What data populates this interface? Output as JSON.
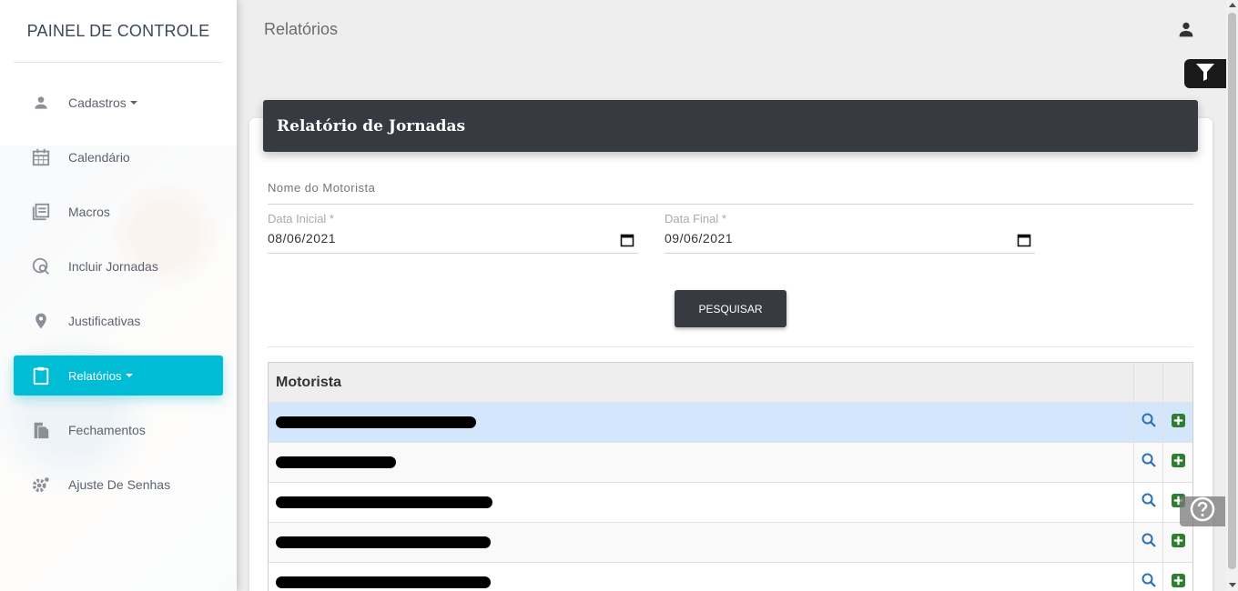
{
  "sidebar": {
    "brand": "PAINEL DE CONTROLE",
    "items": [
      {
        "label": "Cadastros",
        "icon": "person-icon",
        "caret": true
      },
      {
        "label": "Calendário",
        "icon": "calendar-icon"
      },
      {
        "label": "Macros",
        "icon": "library-books-icon"
      },
      {
        "label": "Incluir Jornadas",
        "icon": "search-document-icon"
      },
      {
        "label": "Justificativas",
        "icon": "location-pin-icon"
      },
      {
        "label": "Relatórios",
        "icon": "clipboard-icon",
        "caret": true,
        "active": true
      },
      {
        "label": "Fechamentos",
        "icon": "copy-document-icon"
      },
      {
        "label": "Ajuste De Senhas",
        "icon": "settings-cog-icon"
      }
    ]
  },
  "header": {
    "title": "Relatórios"
  },
  "card": {
    "title": "Relatório de Jornadas",
    "driver_name_placeholder": "Nome do Motorista",
    "start_date_label": "Data Inicial *",
    "start_date_value": "08/06/2021",
    "end_date_label": "Data Final *",
    "end_date_value": "09/06/2021",
    "search_button": "PESQUISAR"
  },
  "table": {
    "header": "Motorista",
    "rows": [
      {
        "redacted": true,
        "selected": true
      },
      {
        "redacted": true
      },
      {
        "redacted": true
      },
      {
        "redacted": true
      },
      {
        "redacted": true
      }
    ]
  },
  "colors": {
    "accent": "#00bcd4",
    "header_dark": "#373a40",
    "selected_row": "#d3e6fb",
    "add_icon": "#2e7d32",
    "search_icon": "#2a6fb0"
  }
}
